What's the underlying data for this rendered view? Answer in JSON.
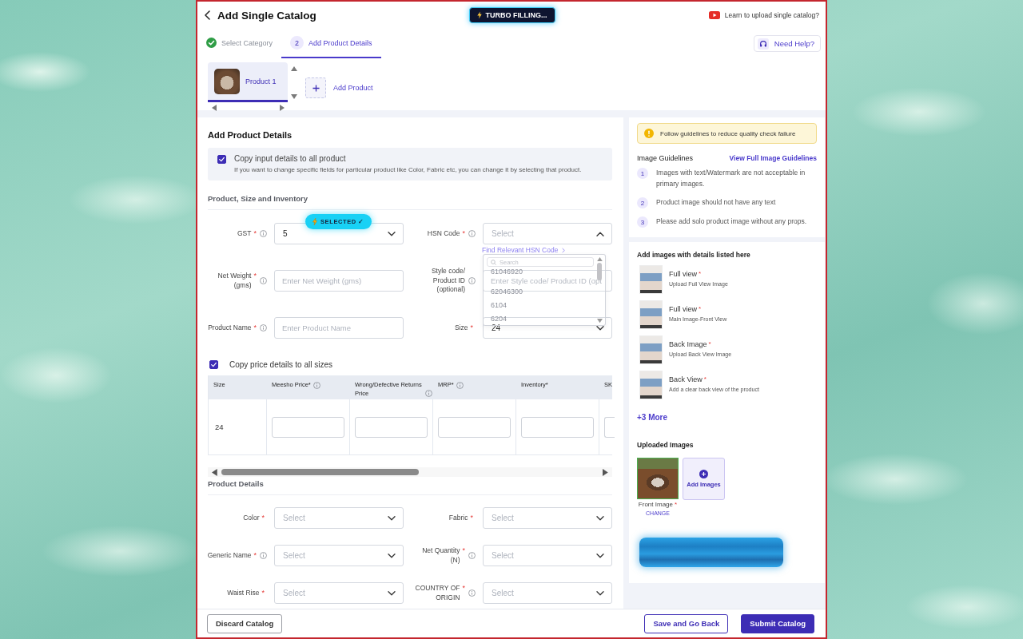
{
  "header": {
    "title": "Add Single Catalog",
    "turbo_button": "TURBO FILLING...",
    "video_link": "Learn to upload single catalog?"
  },
  "steps": [
    {
      "label": "Select Category",
      "completed": true,
      "selected": false
    },
    {
      "number": "2",
      "label": "Add Product Details",
      "completed": false,
      "selected": true
    }
  ],
  "help_button": "Need Help?",
  "products": [
    {
      "label": "Product 1",
      "selected": true
    }
  ],
  "add_product": "Add Product",
  "form": {
    "heading": "Add Product Details",
    "copy_all": {
      "checked": true,
      "label": "Copy input details to all product",
      "hint": "If you want to change specific fields for particular product like Color, Fabric etc, you can change it by selecting that product."
    },
    "section": "Product, Size and Inventory",
    "fields": [
      {
        "label": "GST",
        "mark": "*",
        "info": true,
        "kind": "select",
        "value": "5",
        "expanded": false,
        "badge": "SELECTED ✓"
      },
      {
        "label": "HSN Code",
        "mark": "*",
        "info": true,
        "kind": "select",
        "placeholder": "Select",
        "expanded": true
      },
      {
        "label": "Net Weight (gms)",
        "mark": "*",
        "info": true,
        "kind": "input",
        "placeholder": "Enter Net Weight (gms)"
      },
      {
        "label": "Style code/ Product ID (optional)",
        "info": true,
        "kind": "input",
        "placeholder": "Enter Style code/ Product ID (opt"
      },
      {
        "label": "Product Name",
        "mark": "*",
        "info": true,
        "kind": "input",
        "placeholder": "Enter Product Name"
      },
      {
        "label": "Size",
        "mark": "*",
        "info": false,
        "kind": "select",
        "value": "24",
        "expanded": false
      }
    ],
    "hsn_dropdown": {
      "link": "Find Relevant HSN Code",
      "search_placeholder": "Search",
      "options": [
        "61046920",
        "62046300",
        "6104",
        "6204"
      ]
    },
    "copy_price": {
      "checked": true,
      "label": "Copy price details to all sizes"
    },
    "price_table": {
      "columns": [
        {
          "label": "Size",
          "info": false
        },
        {
          "label": "Meesho Price*",
          "info": true
        },
        {
          "label": "Wrong/Defective Returns Price",
          "info": true
        },
        {
          "label": "MRP*",
          "info": true
        },
        {
          "label": "Inventory*",
          "info": false
        },
        {
          "label": "SK",
          "info": false
        }
      ],
      "rows": [
        {
          "size": "24"
        }
      ]
    },
    "details_heading": "Product Details",
    "details_rows": [
      [
        {
          "label": "Color",
          "mark": "*",
          "info": false,
          "kind": "select",
          "placeholder": "Select"
        },
        {
          "label": "Fabric",
          "mark": "*",
          "info": false,
          "kind": "select",
          "placeholder": "Select"
        }
      ],
      [
        {
          "label": "Generic Name",
          "mark": "*",
          "info": true,
          "kind": "select",
          "placeholder": "Select"
        },
        {
          "label": "Net Quantity (N)",
          "mark": "*",
          "info": true,
          "kind": "select",
          "placeholder": "Select"
        }
      ],
      [
        {
          "label": "Waist Rise",
          "mark": "*",
          "info": false,
          "kind": "select",
          "placeholder": "Select"
        },
        {
          "label": "COUNTRY OF ORIGIN",
          "mark": "*",
          "info": true,
          "kind": "select",
          "placeholder": "Select"
        }
      ]
    ]
  },
  "guidelines": {
    "notice": "Follow guidelines to reduce quality check failure",
    "heading": "Image Guidelines",
    "link": "View Full Image Guidelines",
    "items": [
      {
        "number": "1",
        "text": "Images with text/Watermark are not acceptable in primary images."
      },
      {
        "number": "2",
        "text": "Product image should not have any text"
      },
      {
        "number": "3",
        "text": "Please add solo product image without any props."
      }
    ]
  },
  "image_slots": {
    "heading": "Add images with details listed here",
    "items": [
      {
        "title": "Full view",
        "mark": "*",
        "hint": "Upload Full View Image"
      },
      {
        "title": "Full view",
        "mark": "*",
        "hint": "Main Image-Front View"
      },
      {
        "title": "Back Image",
        "mark": "*",
        "hint": "Upload Back View Image"
      },
      {
        "title": "Back View",
        "mark": "*",
        "hint": "Add a clear back view of the product"
      }
    ],
    "more_link": "+3 More"
  },
  "uploaded_images": {
    "heading": "Uploaded Images",
    "images": [
      {
        "label": "Front Image",
        "mark": "*",
        "action": "CHANGE"
      }
    ],
    "add_button": "Add Images"
  },
  "footer": {
    "left_buttons": [
      {
        "label": "Discard Catalog",
        "kind": "secondary"
      }
    ],
    "right_buttons": [
      {
        "label": "Save and Go Back",
        "kind": "outline"
      },
      {
        "label": "Submit Catalog",
        "kind": "primary"
      }
    ]
  }
}
